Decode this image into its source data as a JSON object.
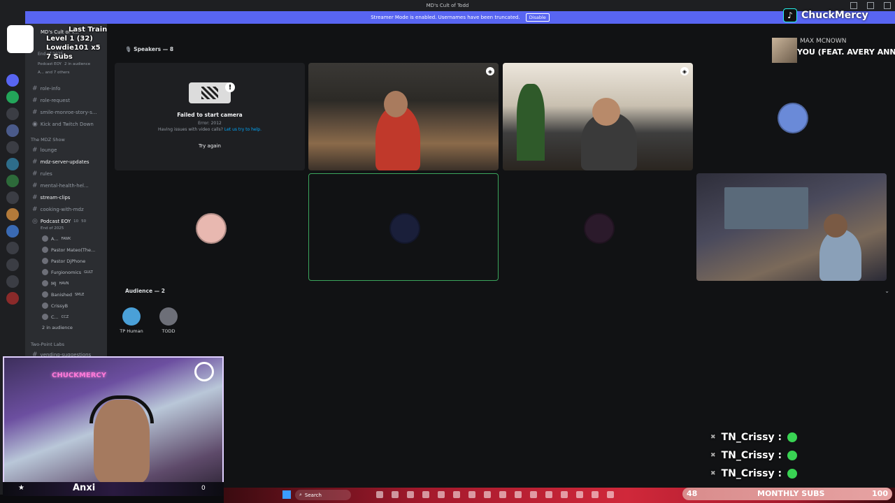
{
  "window": {
    "title": "MD's Cult of Todd"
  },
  "banner": {
    "text": "Streamer Mode is enabled. Usernames have been truncated.",
    "disable_label": "Disable"
  },
  "overlay": {
    "follow_line1": "Last Train",
    "follow_line2": "Level 1 (32)",
    "follow_line3": "Lowdie101 x5",
    "follow_line4": "7 Subs",
    "tiktok_handle": "ChuckMercy",
    "now_playing_artist": "MAX MCNOWN",
    "now_playing_song": "YOU (FEAT. AVERY ANN"
  },
  "sidebar": {
    "server_name": "MD's Cult of T...",
    "event_name": "End of 2025",
    "stage_info": "Podcast EOY",
    "audience_note": "2 in audience",
    "others_note": "A... and 7 others",
    "channels": [
      {
        "label": "role-info"
      },
      {
        "label": "role-request"
      },
      {
        "label": "smile-monroe-story-s..."
      },
      {
        "label": "Kick and Twitch Down"
      }
    ],
    "category_mdz": "The MDZ Show",
    "channels_mdz": [
      {
        "label": "lounge"
      },
      {
        "label": "mdz-server-updates"
      },
      {
        "label": "rules"
      },
      {
        "label": "mental-health-hel..."
      },
      {
        "label": "stream-clips"
      },
      {
        "label": "cooking-with-mdz"
      }
    ],
    "stage_channel": "Podcast EOY",
    "stage_counts": "10",
    "stage_limit": "50",
    "stage_sub": "End of 2025",
    "vc_users": [
      {
        "name": "A...",
        "tag": "FAWK"
      },
      {
        "name": "Pastor Mateo(The..."
      },
      {
        "name": "Pastor DjPhone"
      },
      {
        "name": "Furgionomics",
        "tag": "GULT"
      },
      {
        "name": "MJ",
        "tag": "HAVN"
      },
      {
        "name": "Banished",
        "tag": "SMLE"
      },
      {
        "name": "CrissyB"
      },
      {
        "name": "C...",
        "tag": "CCZ"
      }
    ],
    "in_audience": "2 in audience",
    "category_two_point": "Two-Point Labs",
    "channel_vending": "vending-suggestions"
  },
  "stage": {
    "speakers_label": "Speakers — 8",
    "audience_label": "Audience — 2",
    "camera_error": {
      "title": "Failed to start camera",
      "code": "Error: 2012",
      "help_text": "Having issues with video calls?",
      "help_link": "Let us try to help.",
      "retry_label": "Try again"
    },
    "tiles": [
      {
        "color": "#d4a07f"
      },
      {
        "color": "#b83b2b"
      },
      {
        "color": "#c06ba7"
      },
      {
        "color": "#2b2d31"
      }
    ],
    "audience": [
      {
        "name": "TP Human"
      },
      {
        "name": "TODD"
      }
    ]
  },
  "webcam": {
    "neon_sign": "CHUCKMERCY",
    "name_label": "Anxi",
    "count": "0"
  },
  "chat": [
    {
      "user": "TN_Crissy :"
    },
    {
      "user": "TN_Crissy :"
    },
    {
      "user": "TN_Crissy :"
    }
  ],
  "subs": {
    "current": "48",
    "label": "MONTHLY SUBS",
    "goal": "100"
  },
  "taskbar": {
    "search_placeholder": "Search"
  }
}
